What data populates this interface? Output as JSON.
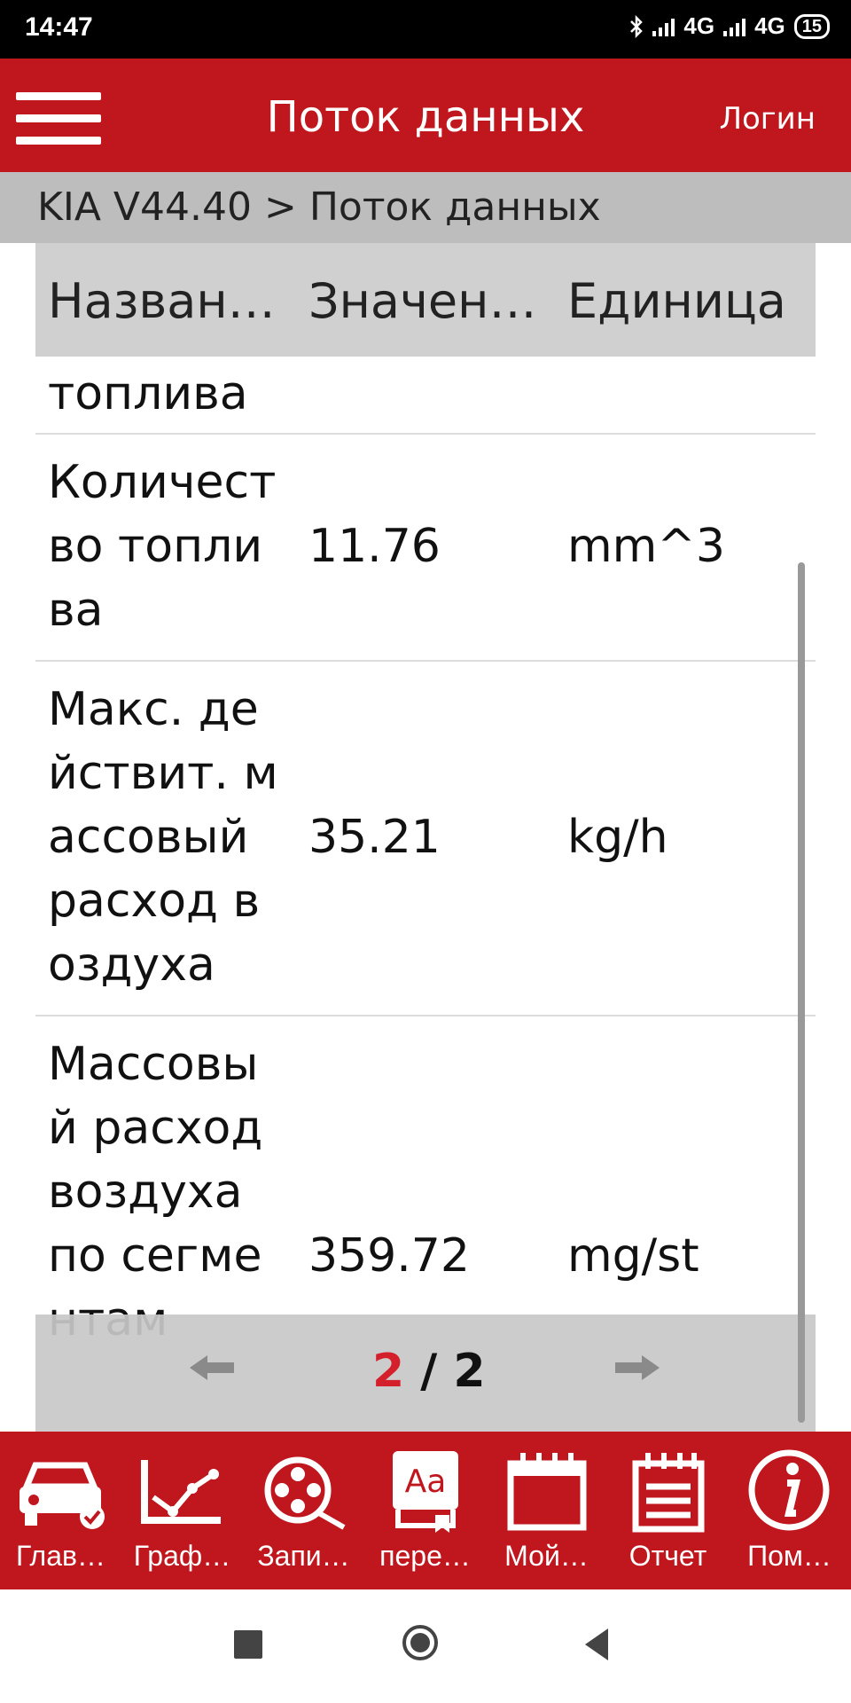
{
  "status": {
    "time": "14:47",
    "net1": "4G",
    "net2": "4G",
    "battery": "15"
  },
  "appbar": {
    "title": "Поток данных",
    "login": "Логин"
  },
  "breadcrumb": "KIA V44.40 > Поток данных",
  "table": {
    "headers": {
      "name": "Назван…",
      "value": "Значен…",
      "unit": "Единица"
    },
    "rows": [
      {
        "name": "топлива",
        "value": "",
        "unit": ""
      },
      {
        "name": "Количество топлива",
        "value": "11.76",
        "unit": "mm^3"
      },
      {
        "name": "Макс. действит. массовый расход воздуха",
        "value": "35.21",
        "unit": "kg/h"
      },
      {
        "name": "Массовый расход воздуха по сегментам",
        "value": "359.72",
        "unit": "mg/st"
      }
    ]
  },
  "pager": {
    "current": "2",
    "separator": " / ",
    "total": "2"
  },
  "toolbar": {
    "items": [
      {
        "label": "Глав…",
        "icon": "car-check-icon"
      },
      {
        "label": "Граф…",
        "icon": "chart-icon"
      },
      {
        "label": "Запи…",
        "icon": "reel-icon"
      },
      {
        "label": "пере…",
        "icon": "translate-icon"
      },
      {
        "label": "Мой…",
        "icon": "calendar-icon"
      },
      {
        "label": "Отчет",
        "icon": "report-icon"
      },
      {
        "label": "Пом…",
        "icon": "info-icon"
      }
    ]
  },
  "colors": {
    "brand": "#c0161d",
    "accent": "#d4202a",
    "header_gray": "#bdbdbd"
  }
}
